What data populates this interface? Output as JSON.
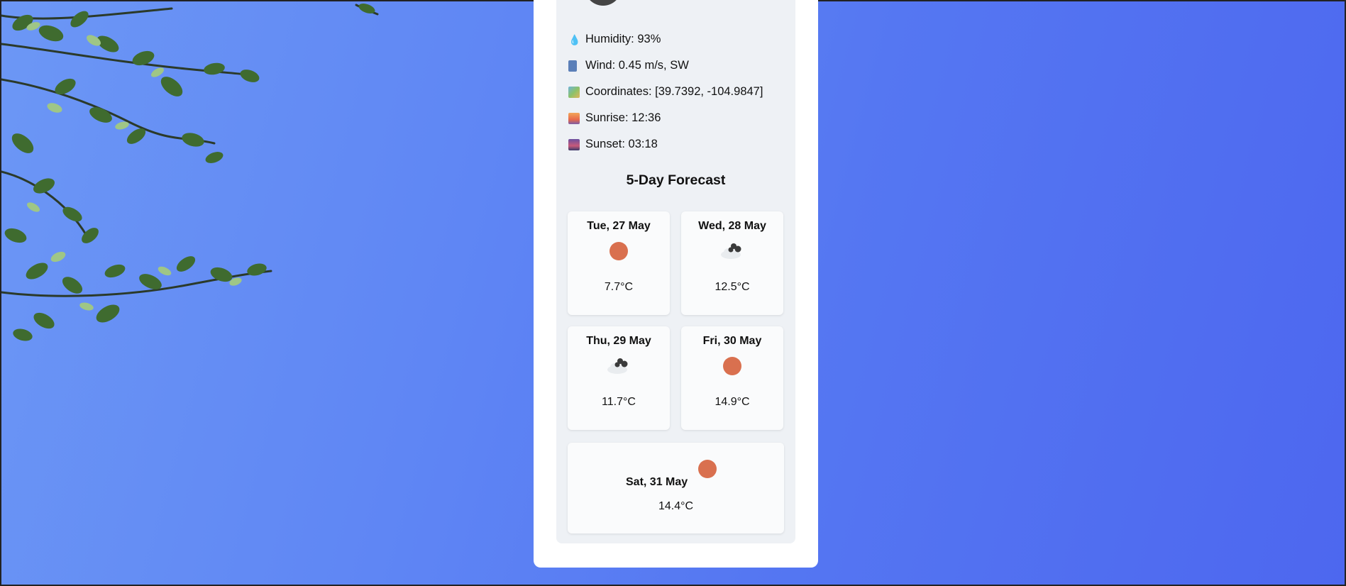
{
  "details": {
    "humidity": {
      "icon": "droplet-icon",
      "text": "Humidity: 93%"
    },
    "wind": {
      "icon": "wind-icon",
      "text": "Wind: 0.45 m/s, SW"
    },
    "coordinates": {
      "icon": "map-icon",
      "text": "Coordinates: [39.7392, -104.9847]"
    },
    "sunrise": {
      "icon": "sunrise-icon",
      "text": "Sunrise: 12:36"
    },
    "sunset": {
      "icon": "sunset-icon",
      "text": "Sunset: 03:18"
    }
  },
  "forecast": {
    "title": "5-Day Forecast",
    "days": [
      {
        "day": "Tue, 27 May",
        "icon": "sun-icon",
        "temp": "7.7°C"
      },
      {
        "day": "Wed, 28 May",
        "icon": "cloud-icon",
        "temp": "12.5°C"
      },
      {
        "day": "Thu, 29 May",
        "icon": "cloud-icon",
        "temp": "11.7°C"
      },
      {
        "day": "Fri, 30 May",
        "icon": "sun-icon",
        "temp": "14.9°C"
      },
      {
        "day": "Sat, 31 May",
        "icon": "sun-icon",
        "temp": "14.4°C"
      }
    ]
  },
  "colors": {
    "sun": "#d9704f",
    "cloud_dark": "#3b3b3b",
    "cloud_light": "#e9ecef",
    "background_start": "#6c97f5",
    "background_end": "#4d67ef"
  }
}
